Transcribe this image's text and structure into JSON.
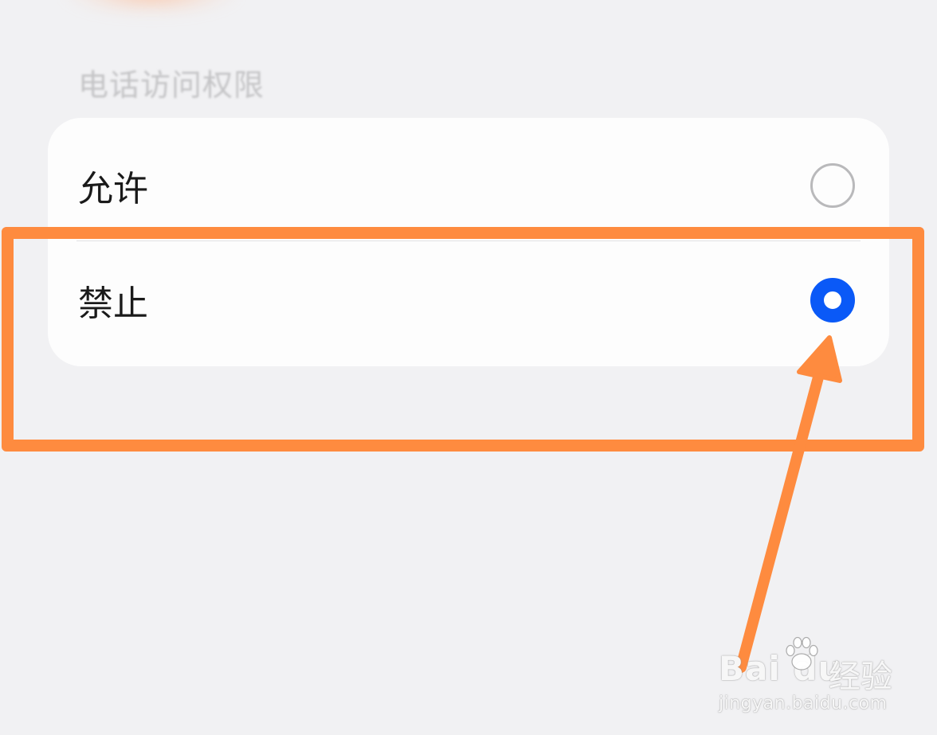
{
  "section": {
    "title": "电话访问权限"
  },
  "options": [
    {
      "label": "允许",
      "selected": false
    },
    {
      "label": "禁止",
      "selected": true
    }
  ],
  "colors": {
    "background": "#f1f1f3",
    "card": "#fdfdfd",
    "radio_selected": "#0a59f7",
    "radio_unselected": "#b9b9bb",
    "annotation": "#fe8b3f"
  },
  "icons": {
    "radio_unselected": "radio-unselected-icon",
    "radio_selected": "radio-selected-icon",
    "annotation_arrow": "arrow-up-icon",
    "watermark_paw": "paw-icon"
  },
  "watermark": {
    "logo_text": "Bai du",
    "logo_cn": "经验",
    "url": "jingyan.baidu.com"
  }
}
